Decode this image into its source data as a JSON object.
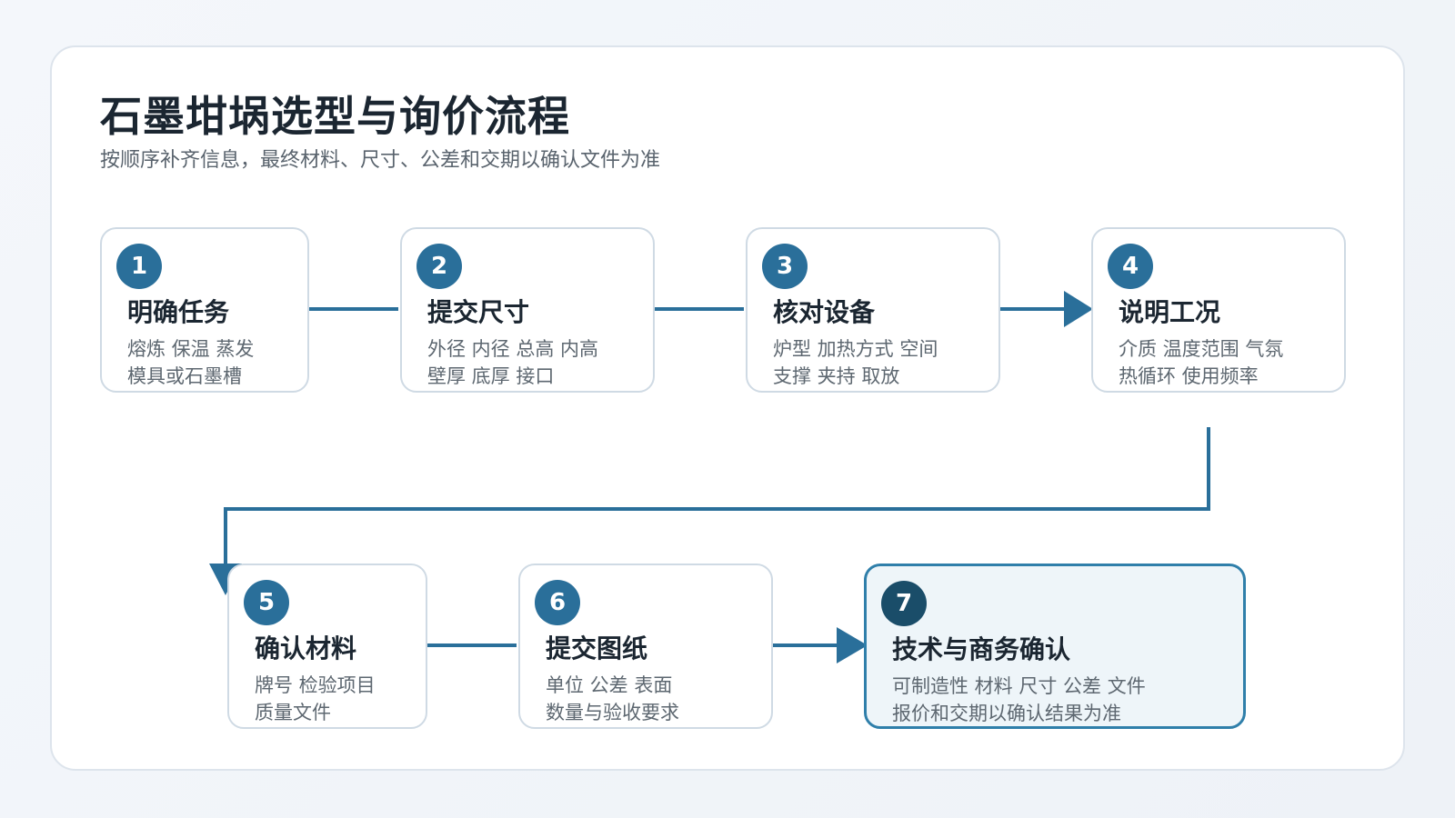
{
  "title": "石墨坩埚选型与询价流程",
  "subtitle": "按顺序补齐信息，最终材料、尺寸、公差和交期以确认文件为准",
  "steps": [
    {
      "number": "1",
      "title": "明确任务",
      "line1": "熔炼 保温 蒸发",
      "line2": "模具或石墨槽"
    },
    {
      "number": "2",
      "title": "提交尺寸",
      "line1": "外径 内径 总高 内高",
      "line2": "壁厚 底厚 接口"
    },
    {
      "number": "3",
      "title": "核对设备",
      "line1": "炉型 加热方式 空间",
      "line2": "支撑 夹持 取放"
    },
    {
      "number": "4",
      "title": "说明工况",
      "line1": "介质 温度范围 气氛",
      "line2": "热循环 使用频率"
    },
    {
      "number": "5",
      "title": "确认材料",
      "line1": "牌号 检验项目",
      "line2": "质量文件"
    },
    {
      "number": "6",
      "title": "提交图纸",
      "line1": "单位 公差 表面",
      "line2": "数量与验收要求"
    },
    {
      "number": "7",
      "title": "技术与商务确认",
      "line1": "可制造性 材料 尺寸 公差 文件",
      "line2": "报价和交期以确认结果为准"
    }
  ],
  "colors": {
    "accent": "#2a6f9a",
    "final_badge": "#1a4d69",
    "final_border": "#2f7faa",
    "final_fill": "#eef5f9"
  }
}
